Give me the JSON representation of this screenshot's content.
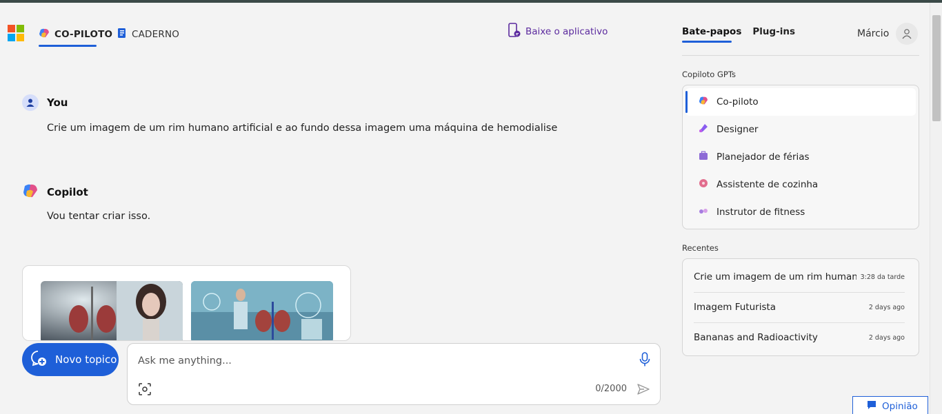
{
  "header": {
    "tabs": [
      {
        "label": "CO-PILOTO",
        "active": true
      },
      {
        "label": "CADERNO",
        "active": false
      }
    ],
    "download_app": "Baixe o aplicativo"
  },
  "conversation": {
    "user": {
      "name": "You",
      "text": "Crie um imagem de um rim humano artificial e ao fundo dessa imagem uma máquina de hemodialise"
    },
    "copilot": {
      "name": "Copilot",
      "text": "Vou tentar criar isso."
    }
  },
  "composer": {
    "new_topic": "Novo topico",
    "placeholder": "Ask me anything...",
    "counter": "0/2000"
  },
  "sidebar": {
    "tabs": [
      {
        "label": "Bate-papos",
        "active": true
      },
      {
        "label": "Plug-ins",
        "active": false
      }
    ],
    "user_name": "Márcio",
    "gpts_label": "Copiloto GPTs",
    "gpts": [
      {
        "label": "Co-piloto",
        "icon": "copilot-icon",
        "active": true
      },
      {
        "label": "Designer",
        "icon": "designer-icon",
        "active": false
      },
      {
        "label": "Planejador de férias",
        "icon": "suitcase-icon",
        "active": false
      },
      {
        "label": "Assistente de cozinha",
        "icon": "donut-icon",
        "active": false
      },
      {
        "label": "Instrutor de fitness",
        "icon": "dumbbell-icon",
        "active": false
      }
    ],
    "recent_label": "Recentes",
    "recent": [
      {
        "title": "Crie um imagem de um rim humano artificial",
        "time": "3:28 da tarde"
      },
      {
        "title": "Imagem Futurista",
        "time": "2 days ago"
      },
      {
        "title": "Bananas and Radioactivity",
        "time": "2 days ago"
      }
    ]
  },
  "feedback": "Opinião",
  "colors": {
    "accent": "#1e5fd8",
    "download_link": "#5b2a9e",
    "background": "#f3f3f3"
  }
}
